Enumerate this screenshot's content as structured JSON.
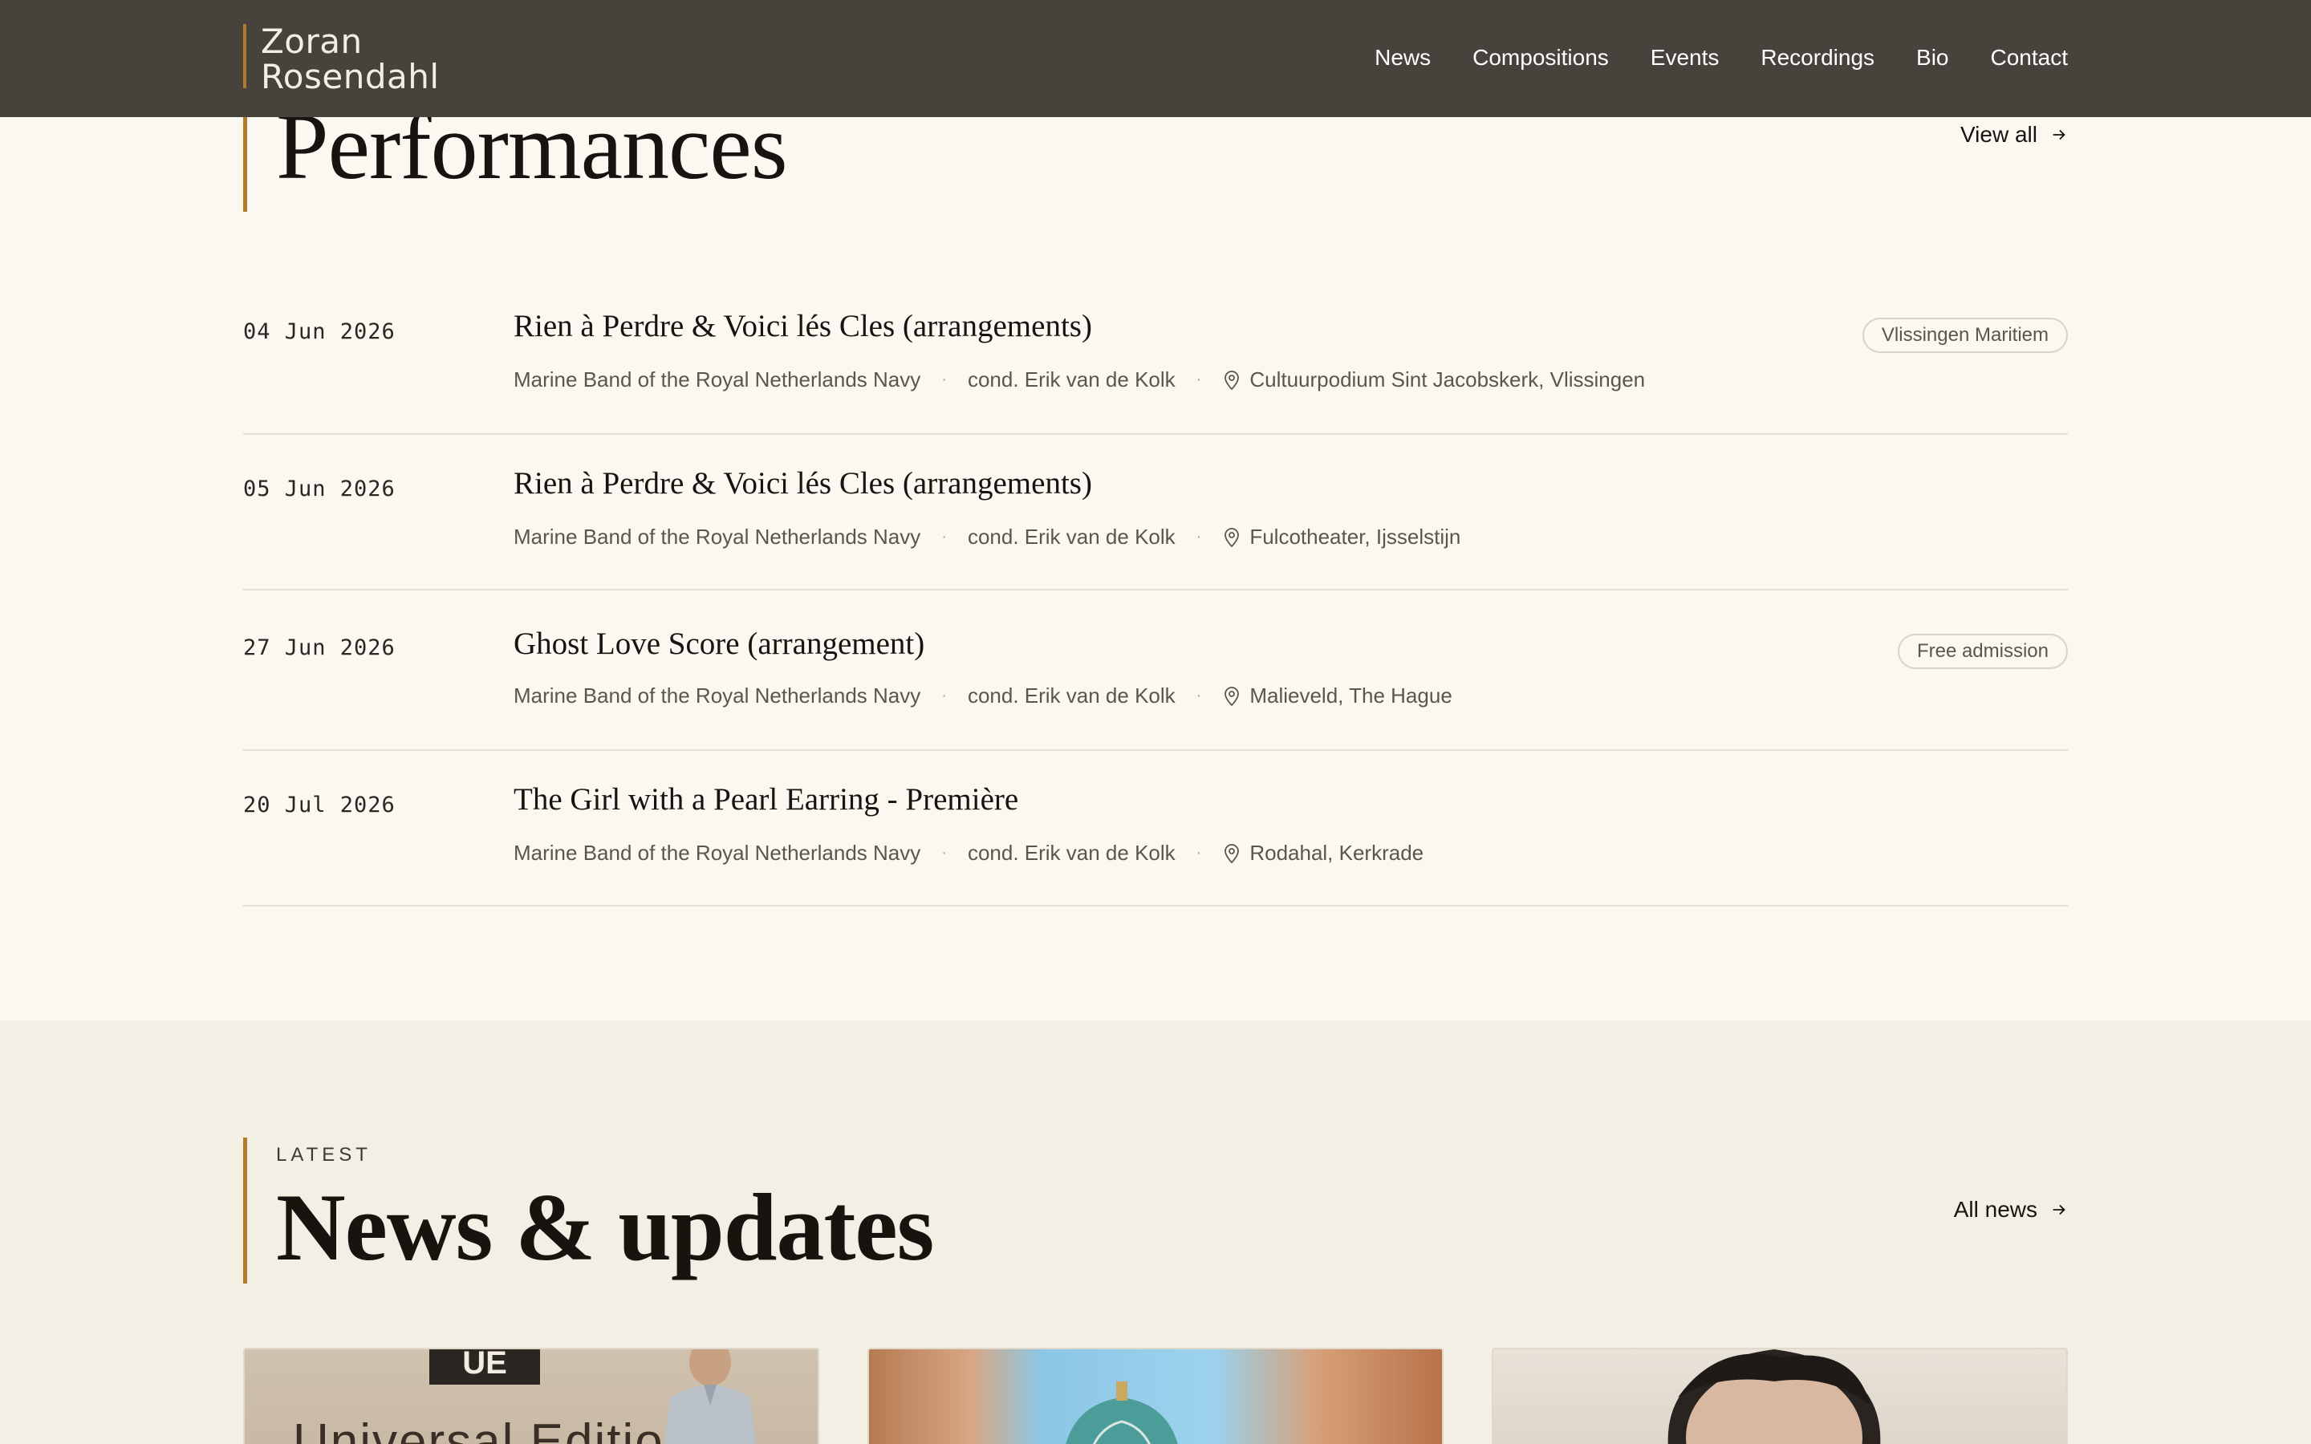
{
  "site": {
    "logo_line1": "Zoran",
    "logo_line2": "Rosendahl"
  },
  "nav": {
    "items": [
      "News",
      "Compositions",
      "Events",
      "Recordings",
      "Bio",
      "Contact"
    ]
  },
  "performances": {
    "title": "Performances",
    "view_all": "View all",
    "events": [
      {
        "date": "04 Jun 2026",
        "title": "Rien à Perdre & Voici lés Cles (arrangements)",
        "ensemble": "Marine Band of the Royal Netherlands Navy",
        "conductor": "cond. Erik van de Kolk",
        "venue": "Cultuurpodium Sint Jacobskerk, Vlissingen",
        "badge": "Vlissingen Maritiem"
      },
      {
        "date": "05 Jun 2026",
        "title": "Rien à Perdre & Voici lés Cles (arrangements)",
        "ensemble": "Marine Band of the Royal Netherlands Navy",
        "conductor": "cond. Erik van de Kolk",
        "venue": "Fulcotheater, Ijsselstijn",
        "badge": ""
      },
      {
        "date": "27 Jun 2026",
        "title": "Ghost Love Score (arrangement)",
        "ensemble": "Marine Band of the Royal Netherlands Navy",
        "conductor": "cond. Erik van de Kolk",
        "venue": "Malieveld, The Hague",
        "badge": "Free admission"
      },
      {
        "date": "20 Jul 2026",
        "title": "The Girl with a Pearl Earring - Première",
        "ensemble": "Marine Band of the Royal Netherlands Navy",
        "conductor": "cond. Erik van de Kolk",
        "venue": "Rodahal, Kerkrade",
        "badge": ""
      }
    ]
  },
  "news": {
    "kicker": "LATEST",
    "title": "News & updates",
    "all_news": "All news",
    "card1_sign_top": "UE",
    "card1_sign_text": "Universal Edition"
  },
  "colors": {
    "header_bg": "#48423d",
    "accent": "#b07d2a",
    "page_bg": "#fbf8f2",
    "news_bg": "#f4efe5"
  }
}
